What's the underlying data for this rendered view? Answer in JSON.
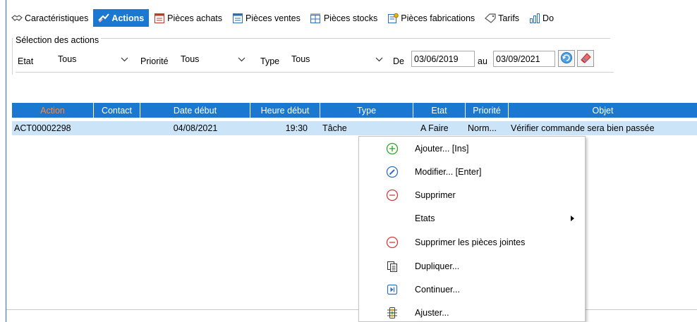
{
  "tabs": [
    {
      "label": "Caractéristiques",
      "icon": "handshake-icon",
      "active": false
    },
    {
      "label": "Actions",
      "icon": "actions-icon",
      "active": true
    },
    {
      "label": "Pièces achats",
      "icon": "purchase-doc-icon",
      "active": false
    },
    {
      "label": "Pièces ventes",
      "icon": "sales-doc-icon",
      "active": false
    },
    {
      "label": "Pièces stocks",
      "icon": "stock-icon",
      "active": false
    },
    {
      "label": "Pièces fabrications",
      "icon": "manufacturing-icon",
      "active": false
    },
    {
      "label": "Tarifs",
      "icon": "tag-icon",
      "active": false
    },
    {
      "label": "Do",
      "icon": "chart-icon",
      "active": false
    }
  ],
  "selection": {
    "title": "Sélection des actions",
    "etat_label": "Etat",
    "etat_value": "Tous",
    "priorite_label": "Priorité",
    "priorite_value": "Tous",
    "type_label": "Type",
    "type_value": "Tous",
    "de_label": "De",
    "date_from": "03/06/2019",
    "au_label": "au",
    "date_to": "03/09/2021"
  },
  "grid": {
    "columns": [
      "Action",
      "Contact",
      "Date début",
      "Heure début",
      "Type",
      "Etat",
      "Priorité",
      "Objet"
    ],
    "rows": [
      {
        "action": "ACT00002298",
        "contact": "",
        "date": "04/08/2021",
        "heure": "19:30",
        "type": "Tâche",
        "etat": "A Faire",
        "priorite": "Norm...",
        "objet": "Vérifier commande sera bien passée"
      }
    ]
  },
  "context_menu": {
    "items": [
      {
        "label": "Ajouter... [Ins]",
        "icon": "add-circle-icon"
      },
      {
        "label": "Modifier... [Enter]",
        "icon": "edit-circle-icon"
      },
      {
        "label": "Supprimer",
        "icon": "remove-circle-icon"
      },
      {
        "label": "Etats",
        "icon": "",
        "submenu": true
      },
      {
        "label": "Supprimer les pièces jointes",
        "icon": "remove-circle-icon"
      },
      {
        "label": "Dupliquer...",
        "icon": "duplicate-icon"
      },
      {
        "label": "Continuer...",
        "icon": "continue-icon"
      },
      {
        "label": "Ajuster...",
        "icon": "adjust-icon"
      }
    ]
  },
  "colors": {
    "accent": "#1a78d0",
    "row_selected": "#cce4f7",
    "header_first": "#ff8a3a"
  }
}
